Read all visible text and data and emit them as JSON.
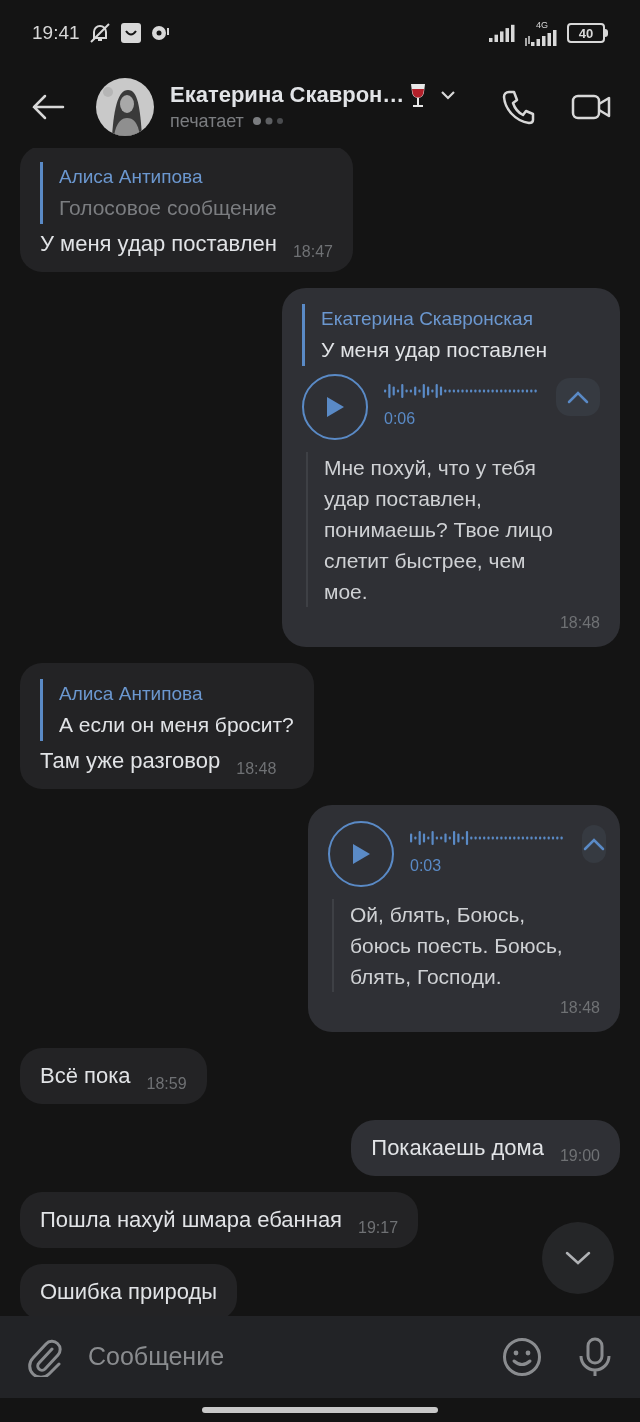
{
  "status_bar": {
    "time": "19:41",
    "network": "4G",
    "battery": "40"
  },
  "header": {
    "name": "Екатерина Скаврон…",
    "status": "печатает"
  },
  "messages": [
    {
      "outgoing": false,
      "reply": {
        "author": "Алиса Антипова",
        "text": "Голосовое сообщение",
        "kind": "voice_note"
      },
      "text": "У меня удар поставлен",
      "time": "18:47"
    },
    {
      "outgoing": true,
      "reply": {
        "author": "Екатерина Скавронская",
        "text": "У меня удар поставлен",
        "kind": "text"
      },
      "voice": {
        "duration": "0:06",
        "transcript": "Мне похуй, что у тебя удар поставлен, понимаешь? Твое лицо слетит быстрее, чем мое."
      },
      "time": "18:48"
    },
    {
      "outgoing": false,
      "reply": {
        "author": "Алиса Антипова",
        "text": "А если он меня бросит?",
        "kind": "text"
      },
      "text": "Там уже разговор",
      "time": "18:48"
    },
    {
      "outgoing": true,
      "voice": {
        "duration": "0:03",
        "transcript": "Ой, блять, Боюсь, боюсь поесть. Боюсь, блять, Господи."
      },
      "time": "18:48"
    },
    {
      "outgoing": false,
      "text": "Всё пока",
      "time": "18:59"
    },
    {
      "outgoing": true,
      "text": "Покакаешь дома",
      "time": "19:00"
    },
    {
      "outgoing": false,
      "text": "Пошла нахуй шмара ебанная",
      "time": "19:17"
    },
    {
      "outgoing": false,
      "text": "Ошибка природы"
    }
  ],
  "composer": {
    "placeholder": "Сообщение"
  }
}
